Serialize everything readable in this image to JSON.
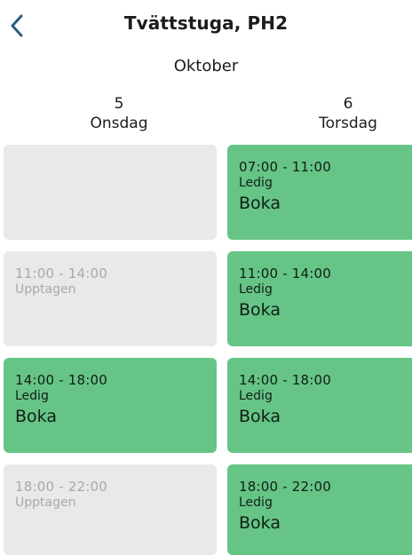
{
  "header": {
    "title": "Tvättstuga, PH2",
    "back_icon": "chevron-left-icon",
    "accent_color": "#2f5c7a"
  },
  "month": "Oktober",
  "days": [
    {
      "number": "5",
      "weekday": "Onsdag"
    },
    {
      "number": "6",
      "weekday": "Torsdag"
    }
  ],
  "colors": {
    "free": "#66c486",
    "taken": "#e9e9ea",
    "taken_text": "#a9a9ad"
  },
  "slots": {
    "col0": [
      {
        "state": "empty"
      },
      {
        "state": "taken",
        "time": "11:00 - 14:00",
        "status": "Upptagen"
      },
      {
        "state": "free",
        "time": "14:00 - 18:00",
        "status": "Ledig",
        "action": "Boka"
      },
      {
        "state": "taken",
        "time": "18:00 - 22:00",
        "status": "Upptagen"
      }
    ],
    "col1": [
      {
        "state": "free",
        "time": "07:00 - 11:00",
        "status": "Ledig",
        "action": "Boka"
      },
      {
        "state": "free",
        "time": "11:00 - 14:00",
        "status": "Ledig",
        "action": "Boka"
      },
      {
        "state": "free",
        "time": "14:00 - 18:00",
        "status": "Ledig",
        "action": "Boka"
      },
      {
        "state": "free",
        "time": "18:00 - 22:00",
        "status": "Ledig",
        "action": "Boka"
      }
    ]
  }
}
